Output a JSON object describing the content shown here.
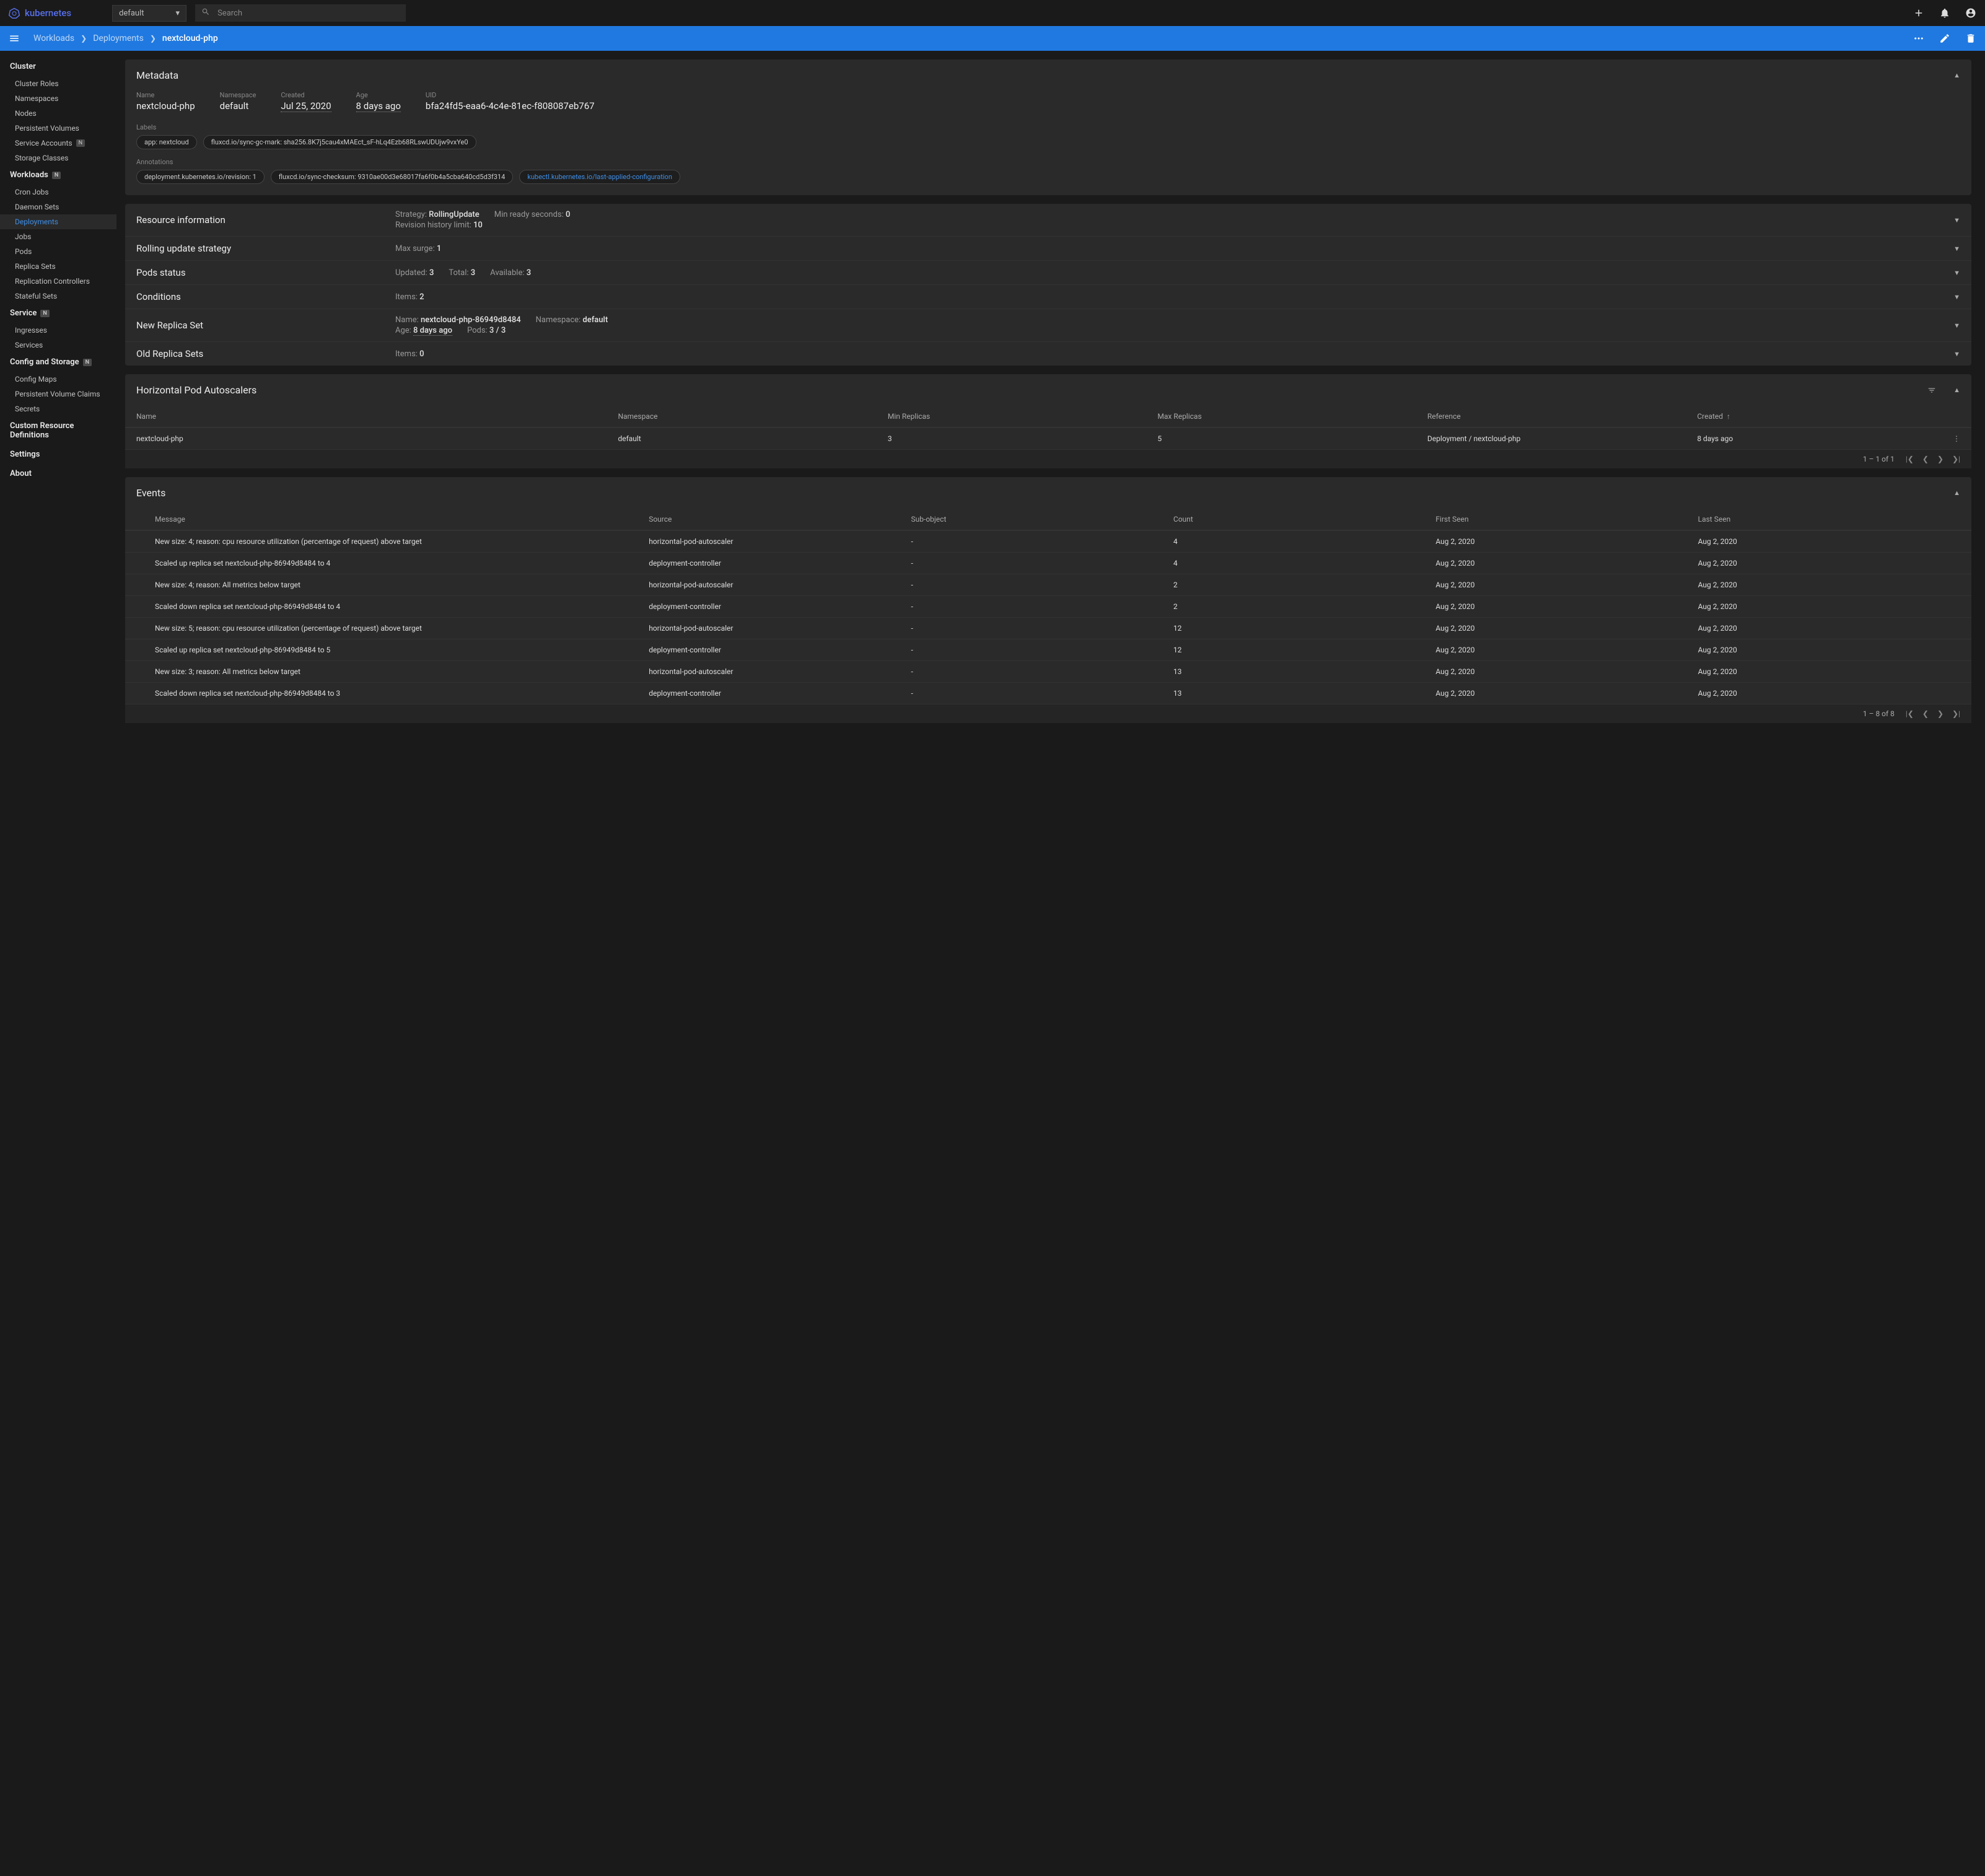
{
  "header": {
    "brand": "kubernetes",
    "namespace_selected": "default",
    "search_placeholder": "Search"
  },
  "breadcrumb": {
    "items": [
      "Workloads",
      "Deployments"
    ],
    "current": "nextcloud-php"
  },
  "sidebar": {
    "sections": [
      {
        "title": "Cluster",
        "items": [
          {
            "label": "Cluster Roles"
          },
          {
            "label": "Namespaces"
          },
          {
            "label": "Nodes"
          },
          {
            "label": "Persistent Volumes"
          },
          {
            "label": "Service Accounts",
            "badge": "N"
          },
          {
            "label": "Storage Classes"
          }
        ]
      },
      {
        "title": "Workloads",
        "title_badge": "N",
        "items": [
          {
            "label": "Cron Jobs"
          },
          {
            "label": "Daemon Sets"
          },
          {
            "label": "Deployments",
            "active": true
          },
          {
            "label": "Jobs"
          },
          {
            "label": "Pods"
          },
          {
            "label": "Replica Sets"
          },
          {
            "label": "Replication Controllers"
          },
          {
            "label": "Stateful Sets"
          }
        ]
      },
      {
        "title": "Service",
        "title_badge": "N",
        "items": [
          {
            "label": "Ingresses"
          },
          {
            "label": "Services"
          }
        ]
      },
      {
        "title": "Config and Storage",
        "title_badge": "N",
        "items": [
          {
            "label": "Config Maps"
          },
          {
            "label": "Persistent Volume Claims"
          },
          {
            "label": "Secrets"
          }
        ]
      },
      {
        "title": "Custom Resource Definitions"
      },
      {
        "title": "Settings"
      },
      {
        "title": "About"
      }
    ]
  },
  "metadata": {
    "title": "Metadata",
    "name_label": "Name",
    "name": "nextcloud-php",
    "namespace_label": "Namespace",
    "namespace": "default",
    "created_label": "Created",
    "created": "Jul 25, 2020",
    "age_label": "Age",
    "age": "8 days ago",
    "uid_label": "UID",
    "uid": "bfa24fd5-eaa6-4c4e-81ec-f808087eb767",
    "labels_label": "Labels",
    "labels": [
      "app: nextcloud",
      "fluxcd.io/sync-gc-mark: sha256.8K7j5cau4xMAEct_sF-hLq4Ezb68RLswUDUjw9vxYe0"
    ],
    "annotations_label": "Annotations",
    "annotations": [
      {
        "text": "deployment.kubernetes.io/revision: 1"
      },
      {
        "text": "fluxcd.io/sync-checksum: 9310ae00d3e68017fa6f0b4a5cba640cd5d3f314"
      },
      {
        "text": "kubectl.kubernetes.io/last-applied-configuration",
        "link": true
      }
    ]
  },
  "resource_info": [
    {
      "title": "Resource information",
      "lines": [
        [
          {
            "k": "Strategy:",
            "v": "RollingUpdate"
          },
          {
            "k": "Min ready seconds:",
            "v": "0"
          }
        ],
        [
          {
            "k": "Revision history limit:",
            "v": "10"
          }
        ]
      ]
    },
    {
      "title": "Rolling update strategy",
      "lines": [
        [
          {
            "k": "Max surge:",
            "v": "1"
          }
        ]
      ]
    },
    {
      "title": "Pods status",
      "lines": [
        [
          {
            "k": "Updated:",
            "v": "3"
          },
          {
            "k": "Total:",
            "v": "3"
          },
          {
            "k": "Available:",
            "v": "3"
          }
        ]
      ]
    },
    {
      "title": "Conditions",
      "lines": [
        [
          {
            "k": "Items:",
            "v": "2"
          }
        ]
      ]
    },
    {
      "title": "New Replica Set",
      "lines": [
        [
          {
            "k": "Name:",
            "v": "nextcloud-php-86949d8484"
          },
          {
            "k": "Namespace:",
            "v": "default"
          }
        ],
        [
          {
            "k": "Age:",
            "v": "8 days ago",
            "underline": true
          },
          {
            "k": "Pods:",
            "v": "3 / 3"
          }
        ]
      ]
    },
    {
      "title": "Old Replica Sets",
      "lines": [
        [
          {
            "k": "Items:",
            "v": "0"
          }
        ]
      ]
    }
  ],
  "hpa": {
    "title": "Horizontal Pod Autoscalers",
    "headers": {
      "name": "Name",
      "namespace": "Namespace",
      "min": "Min Replicas",
      "max": "Max Replicas",
      "reference": "Reference",
      "created": "Created"
    },
    "rows": [
      {
        "name": "nextcloud-php",
        "namespace": "default",
        "min": "3",
        "max": "5",
        "reference": "Deployment / nextcloud-php",
        "created": "8 days ago"
      }
    ],
    "pagination": "1 – 1 of 1"
  },
  "events": {
    "title": "Events",
    "headers": {
      "message": "Message",
      "source": "Source",
      "sub": "Sub-object",
      "count": "Count",
      "first": "First Seen",
      "last": "Last Seen"
    },
    "rows": [
      {
        "message": "New size: 4; reason: cpu resource utilization (percentage of request) above target",
        "source": "horizontal-pod-autoscaler",
        "sub": "-",
        "count": "4",
        "first": "Aug 2, 2020",
        "last": "Aug 2, 2020"
      },
      {
        "message": "Scaled up replica set nextcloud-php-86949d8484 to 4",
        "source": "deployment-controller",
        "sub": "-",
        "count": "4",
        "first": "Aug 2, 2020",
        "last": "Aug 2, 2020"
      },
      {
        "message": "New size: 4; reason: All metrics below target",
        "source": "horizontal-pod-autoscaler",
        "sub": "-",
        "count": "2",
        "first": "Aug 2, 2020",
        "last": "Aug 2, 2020"
      },
      {
        "message": "Scaled down replica set nextcloud-php-86949d8484 to 4",
        "source": "deployment-controller",
        "sub": "-",
        "count": "2",
        "first": "Aug 2, 2020",
        "last": "Aug 2, 2020"
      },
      {
        "message": "New size: 5; reason: cpu resource utilization (percentage of request) above target",
        "source": "horizontal-pod-autoscaler",
        "sub": "-",
        "count": "12",
        "first": "Aug 2, 2020",
        "last": "Aug 2, 2020"
      },
      {
        "message": "Scaled up replica set nextcloud-php-86949d8484 to 5",
        "source": "deployment-controller",
        "sub": "-",
        "count": "12",
        "first": "Aug 2, 2020",
        "last": "Aug 2, 2020"
      },
      {
        "message": "New size: 3; reason: All metrics below target",
        "source": "horizontal-pod-autoscaler",
        "sub": "-",
        "count": "13",
        "first": "Aug 2, 2020",
        "last": "Aug 2, 2020"
      },
      {
        "message": "Scaled down replica set nextcloud-php-86949d8484 to 3",
        "source": "deployment-controller",
        "sub": "-",
        "count": "13",
        "first": "Aug 2, 2020",
        "last": "Aug 2, 2020"
      }
    ],
    "pagination": "1 – 8 of 8"
  }
}
